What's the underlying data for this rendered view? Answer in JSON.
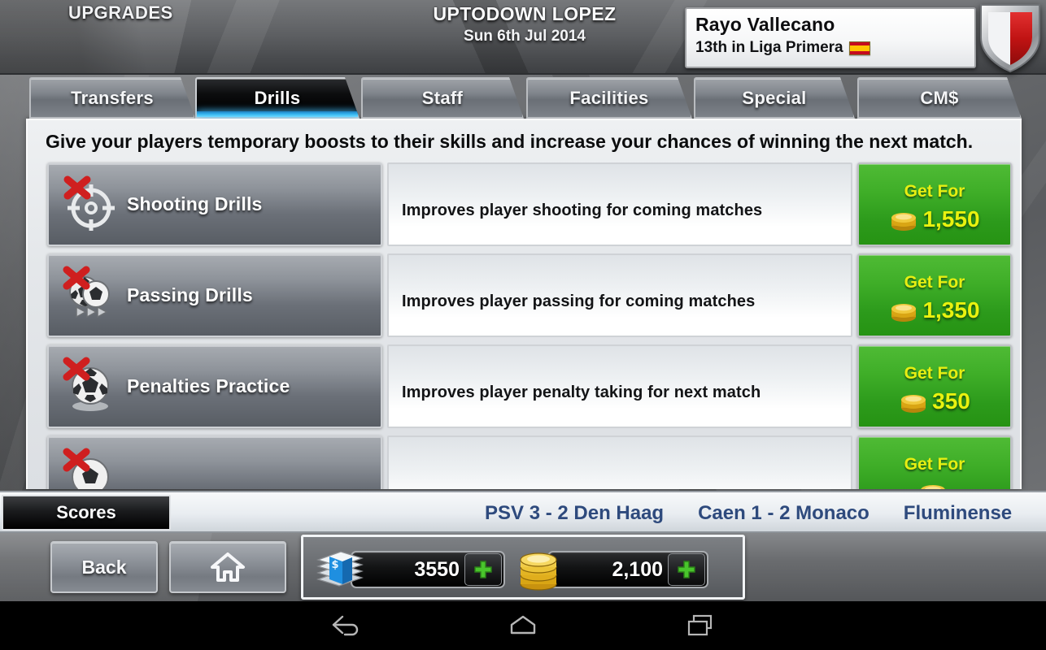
{
  "header": {
    "section_label": "UPGRADES",
    "title": "UPTODOWN LOPEZ",
    "date": "Sun 6th Jul 2014",
    "team_name": "Rayo Vallecano",
    "team_rank": "13th in Liga Primera",
    "flag": "spain-flag-icon",
    "crest": "team-crest-shield-icon"
  },
  "tabs": [
    {
      "label": "Transfers",
      "active": false
    },
    {
      "label": "Drills",
      "active": true
    },
    {
      "label": "Staff",
      "active": false
    },
    {
      "label": "Facilities",
      "active": false
    },
    {
      "label": "Special",
      "active": false
    },
    {
      "label": "CM$",
      "active": false
    }
  ],
  "panel": {
    "intro": "Give your players temporary boosts to their skills and increase your chances of winning the next match.",
    "buy_label": "Get For",
    "rows": [
      {
        "icon": "crosshair-target-locked-icon",
        "name": "Shooting Drills",
        "description": "Improves player shooting for coming matches",
        "price": "1,550",
        "locked": true
      },
      {
        "icon": "football-passing-locked-icon",
        "name": "Passing Drills",
        "description": "Improves player passing for coming matches",
        "price": "1,350",
        "locked": true
      },
      {
        "icon": "football-penalty-spot-locked-icon",
        "name": "Penalties Practice",
        "description": "Improves player penalty taking for next match",
        "price": "350",
        "locked": true
      },
      {
        "icon": "football-locked-icon",
        "name": "",
        "description": "",
        "price": "",
        "locked": true
      }
    ]
  },
  "scores": {
    "label": "Scores",
    "items": [
      "PSV 3 - 2 Den Haag",
      "Caen 1 - 2 Monaco",
      "Fluminense"
    ]
  },
  "bottom": {
    "back_label": "Back",
    "home_icon": "home-icon",
    "cash_icon": "banknote-stack-icon",
    "cash_value": "3550",
    "coins_icon": "gold-coin-stack-icon",
    "coins_value": "2,100",
    "add_icon": "plus-icon"
  },
  "android_nav": {
    "back": "android-back-icon",
    "home": "android-home-icon",
    "recents": "android-recents-icon"
  },
  "colors": {
    "accent_green": "#3fae28",
    "price_yellow": "#e9f20f",
    "active_tab_glow": "#35b6f0",
    "score_text": "#2e4a7d"
  }
}
